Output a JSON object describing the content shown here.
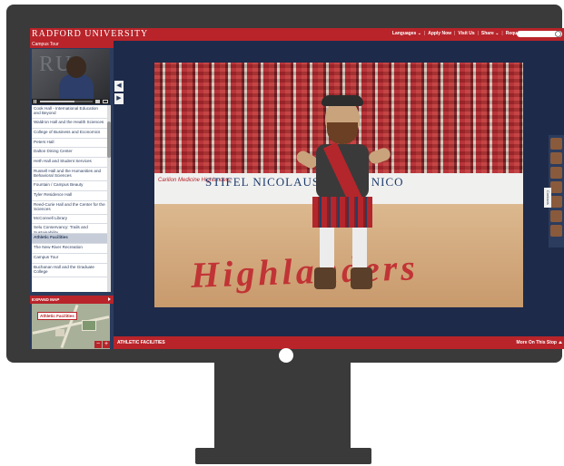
{
  "header": {
    "brand": "RADFORD UNIVERSITY",
    "nav": [
      "Languages ⌄",
      "Apply Now",
      "Visit Us",
      "Share ⌄",
      "Request Info"
    ],
    "separator": "|"
  },
  "sidebar": {
    "title": "Campus Tour",
    "video_bg_text": "RU",
    "items": [
      {
        "label": "Cook Hall - International Education and Beyond",
        "tall": true
      },
      {
        "label": "Waldron Hall and the Health Sciences"
      },
      {
        "label": "College of Business and Economics"
      },
      {
        "label": "Peters Hall"
      },
      {
        "label": "Dalton Dining Center"
      },
      {
        "label": "Heth Hall and Student Services"
      },
      {
        "label": "Russell Hall and the Humanities and Behavioral Sciences",
        "tall": true
      },
      {
        "label": "Fountain / Campus Beauty"
      },
      {
        "label": "Tyler Residence Hall"
      },
      {
        "label": "Reed-Curie Hall and the Center for the Sciences",
        "tall": true
      },
      {
        "label": "McConnell Library"
      },
      {
        "label": "Selu Conservancy: Trails and Sustainability"
      },
      {
        "label": "Athletic Facilities",
        "active": true
      },
      {
        "label": "The New River Recreation"
      },
      {
        "label": "Campus Tour"
      },
      {
        "label": "Buchanan Hall and the Graduate College",
        "tall": true
      }
    ],
    "expand_label": "EXPAND MAP",
    "map_label": "Athletic Facilities",
    "zoom_out": "−",
    "zoom_in": "+"
  },
  "nav_arrows": {
    "prev": "◀",
    "next": "▶"
  },
  "photo": {
    "banner_left": "Carilion Medicine Highlanders",
    "banner_center": "STIFEL NICOLAUS  STIFEL NICO",
    "court_logo": "Highlanders"
  },
  "right_panel": {
    "contacts_label": "Contacts"
  },
  "footer": {
    "title": "ATHLETIC FACILITIES",
    "more": "More On This Stop"
  },
  "colors": {
    "brand_red": "#b8242a",
    "navy": "#1d2a4a",
    "bezel": "#3a3a3a"
  }
}
